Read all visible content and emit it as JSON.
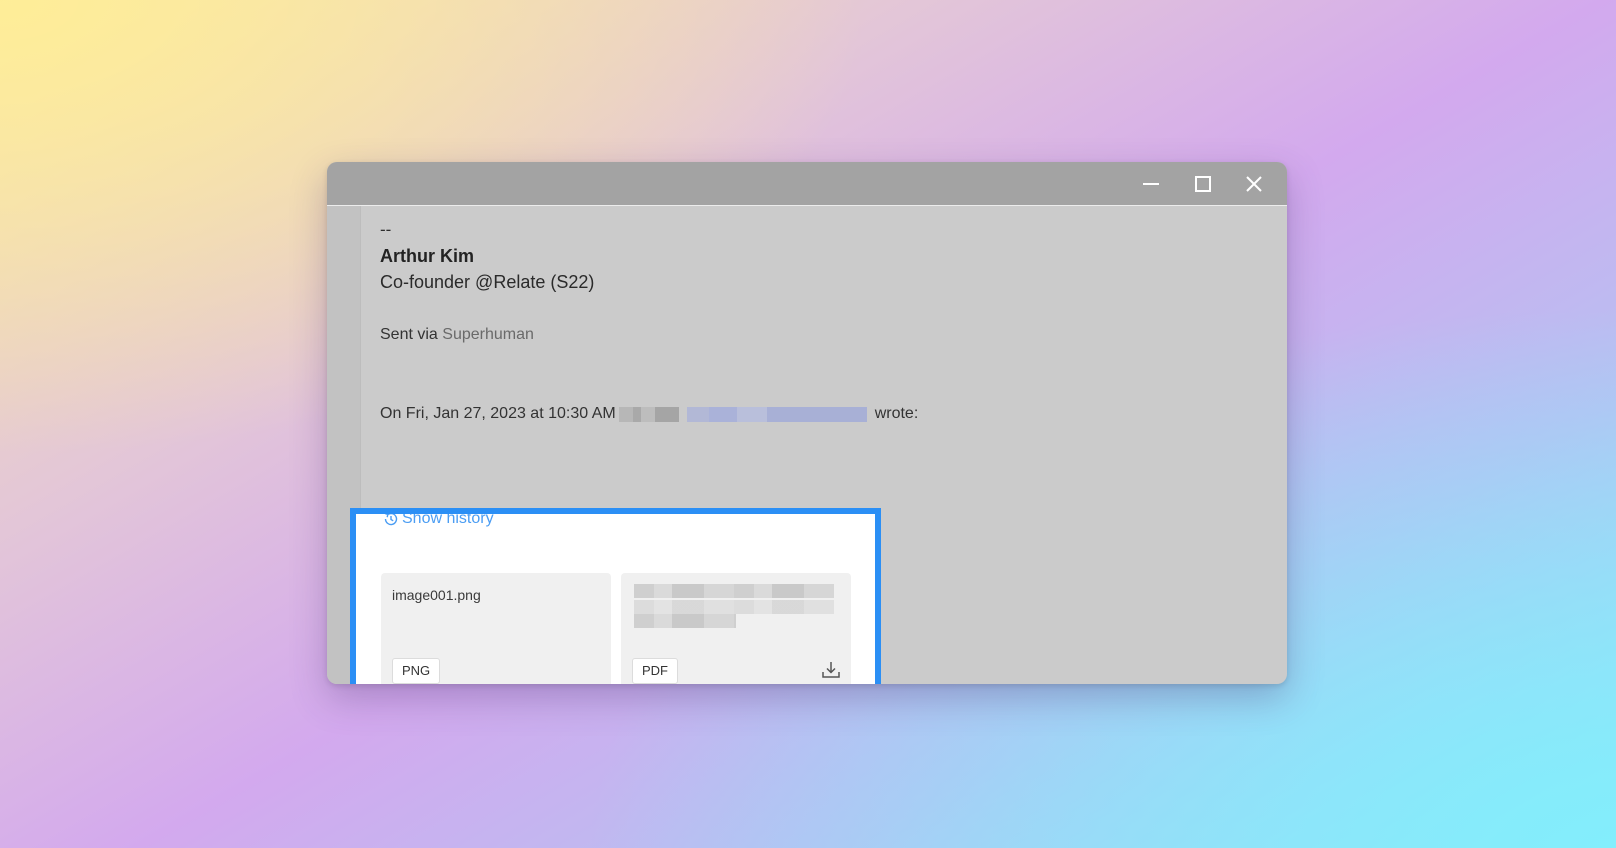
{
  "signature": {
    "separator": "--",
    "name": "Arthur Kim",
    "role": "Co-founder @Relate (S22)"
  },
  "sent_via": {
    "prefix": "Sent via",
    "link_text": "Superhuman"
  },
  "quote_header": {
    "prefix": "On Fri, Jan 27, 2023 at 10:30 AM",
    "suffix": "wrote:"
  },
  "history": {
    "label": "Show history",
    "icon": "clock-icon"
  },
  "attachments": [
    {
      "name": "image001.png",
      "type": "PNG"
    },
    {
      "name": "",
      "type": "PDF",
      "action_icon": "download-icon"
    }
  ],
  "window_controls": [
    "minimize-icon",
    "maximize-icon",
    "close-icon"
  ],
  "colors": {
    "highlight_border": "#2b8ff5",
    "link_blue": "#4b9df3"
  }
}
